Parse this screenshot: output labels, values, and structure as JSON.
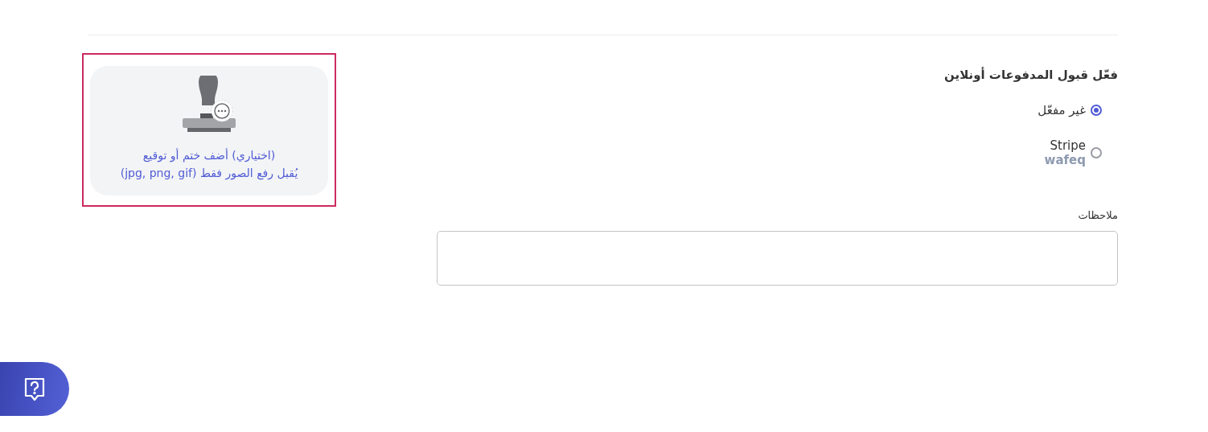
{
  "upload": {
    "highlighted": true,
    "lines": [
      "(اختياري) أضف ختم أو توقيع",
      "يُقبل رفع الصور فقط (jpg, png, gif)"
    ]
  },
  "online_payments": {
    "title": "فعّل قبول المدفوعات أونلاين",
    "options": [
      {
        "label": "غير مفعّل",
        "selected": true
      },
      {
        "label": "Stripe",
        "sublabel": "wafeq",
        "selected": false
      }
    ]
  },
  "notes": {
    "label": "ملاحظات"
  }
}
